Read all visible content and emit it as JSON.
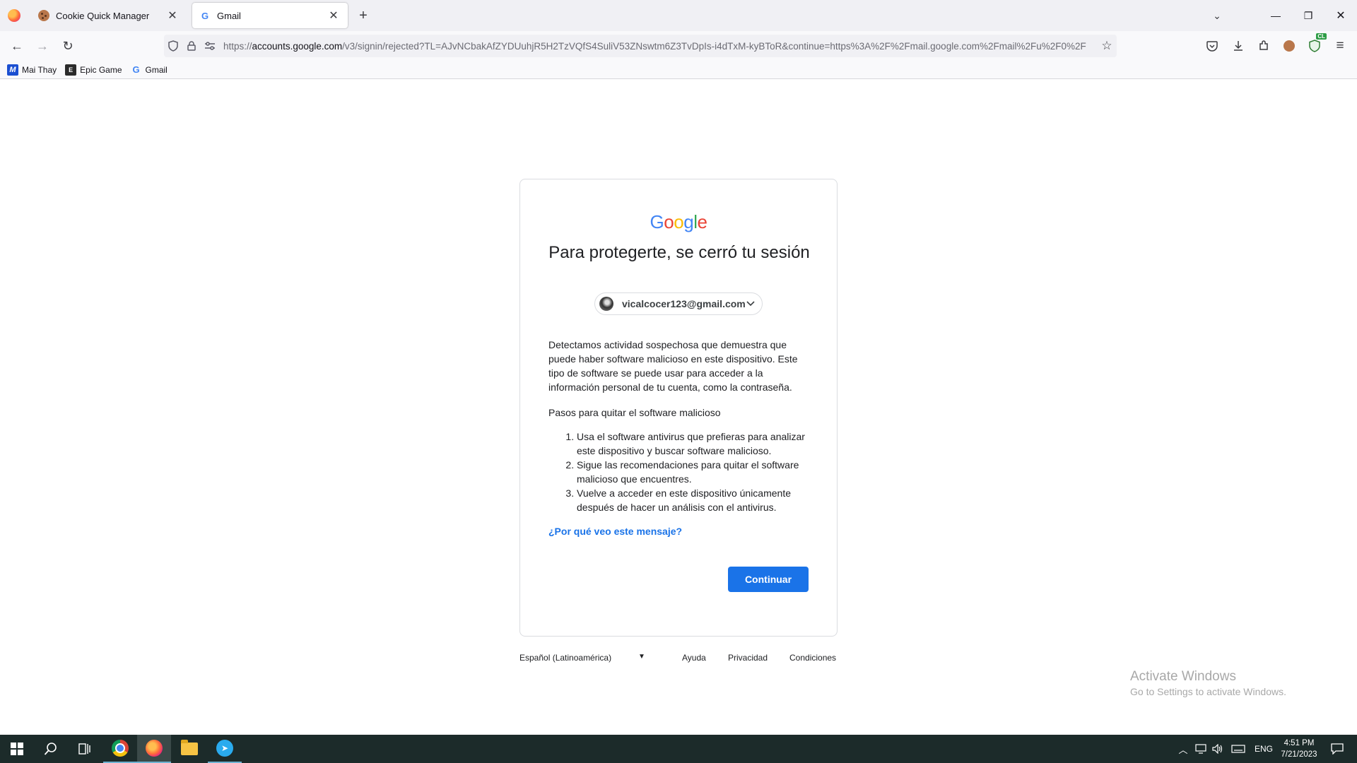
{
  "browser": {
    "tabs": [
      {
        "label": "Cookie Quick Manager",
        "close": "✕"
      },
      {
        "label": "Gmail",
        "close": "✕"
      }
    ],
    "new_tab": "+",
    "tab_list": "⌄",
    "window": {
      "minimize": "—",
      "maximize": "❐",
      "close": "✕"
    },
    "nav": {
      "back": "←",
      "forward": "→",
      "reload": "↻"
    },
    "url": {
      "prefix": "https://",
      "host": "accounts.google.com",
      "rest": "/v3/signin/rejected?TL=AJvNCbakAfZYDUuhjR5H2TzVQfS4SuliV53ZNswtm6Z3TvDpIs-i4dTxM-kyBToR&continue=https%3A%2F%2Fmail.google.com%2Fmail%2Fu%2F0%2F"
    },
    "bookmarks": [
      {
        "label": "Mai Thay",
        "icon": "M"
      },
      {
        "label": "Epic Game",
        "icon": "E"
      },
      {
        "label": "Gmail",
        "icon": "G"
      }
    ],
    "toolbar_icons": [
      "pocket-icon",
      "download-icon",
      "extensions-icon",
      "cookie-icon",
      "ublock-icon",
      "menu-icon"
    ]
  },
  "page": {
    "logo_letters": [
      {
        "ch": "G",
        "color": "#4285F4"
      },
      {
        "ch": "o",
        "color": "#EA4335"
      },
      {
        "ch": "o",
        "color": "#FBBC05"
      },
      {
        "ch": "g",
        "color": "#4285F4"
      },
      {
        "ch": "l",
        "color": "#34A853"
      },
      {
        "ch": "e",
        "color": "#EA4335"
      }
    ],
    "title": "Para protegerte, se cerró tu sesión",
    "account_email": "vicalcocer123@gmail.com",
    "message": "Detectamos actividad sospechosa que demuestra que puede haber software malicioso en este dispositivo. Este tipo de software se puede usar para acceder a la información personal de tu cuenta, como la contraseña.",
    "steps_title": "Pasos para quitar el software malicioso",
    "steps": [
      "Usa el software antivirus que prefieras para analizar este dispositivo y buscar software malicioso.",
      "Sigue las recomendaciones para quitar el software malicioso que encuentres.",
      "Vuelve a acceder en este dispositivo únicamente después de hacer un análisis con el antivirus."
    ],
    "why_link": "¿Por qué veo este mensaje?",
    "continue_label": "Continuar",
    "accent_color": "#1A73E8"
  },
  "footer": {
    "language": "Español (Latinoamérica)",
    "help": "Ayuda",
    "privacy": "Privacidad",
    "terms": "Condiciones"
  },
  "watermark": {
    "title": "Activate Windows",
    "subtitle": "Go to Settings to activate Windows."
  },
  "taskbar": {
    "language": "ENG",
    "time": "4:51 PM",
    "date": "7/21/2023"
  }
}
